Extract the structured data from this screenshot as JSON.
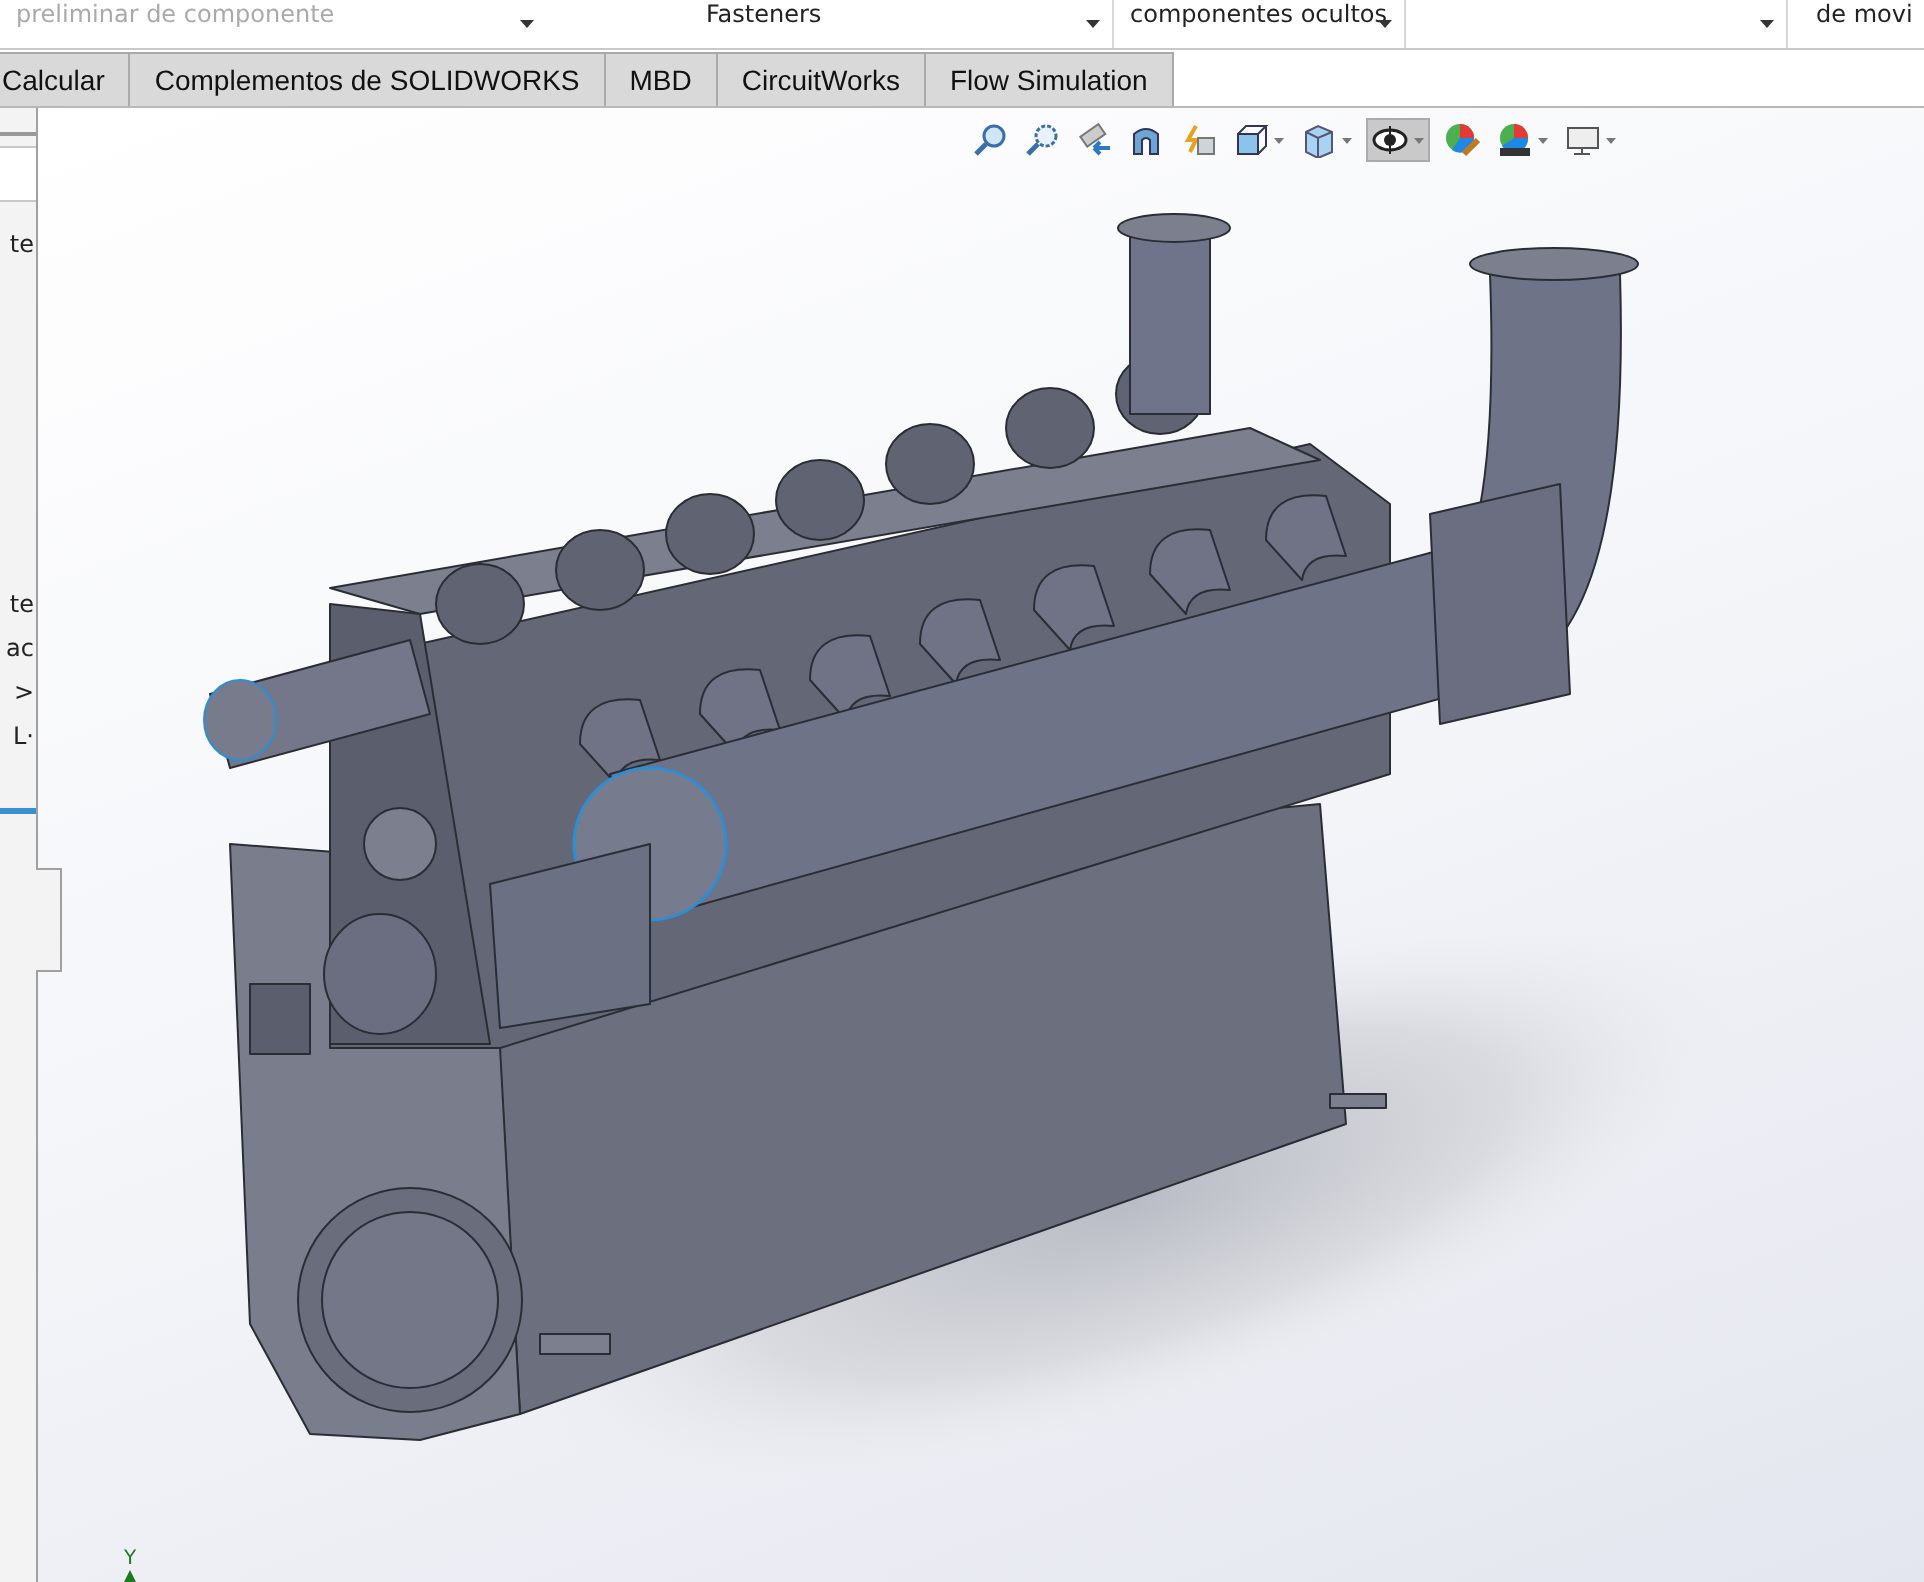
{
  "ribbon": {
    "items": [
      {
        "label": "preliminar de componente",
        "dropdown": true
      },
      {
        "label": "Fasteners",
        "dropdown": true
      },
      {
        "label": "componentes ocultos",
        "dropdown": true
      },
      {
        "dropdown": true
      },
      {
        "label": "de movi",
        "dropdown": false
      }
    ]
  },
  "tabs": [
    {
      "label": "Calcular"
    },
    {
      "label": "Complementos de SOLIDWORKS"
    },
    {
      "label": "MBD"
    },
    {
      "label": "CircuitWorks"
    },
    {
      "label": "Flow Simulation"
    }
  ],
  "left_panel": {
    "items": [
      {
        "label": "te"
      },
      {
        "label": "te"
      },
      {
        "label": "ac"
      },
      {
        "label": ">"
      },
      {
        "label": "L·"
      }
    ]
  },
  "view_toolbar": [
    {
      "kind": "zoom-fit",
      "dropdown": false,
      "pressed": false
    },
    {
      "kind": "zoom-area",
      "dropdown": false,
      "pressed": false
    },
    {
      "kind": "previous-view",
      "dropdown": false,
      "pressed": false
    },
    {
      "kind": "section",
      "dropdown": false,
      "pressed": false
    },
    {
      "kind": "annotation",
      "dropdown": false,
      "pressed": false
    },
    {
      "kind": "orientation",
      "dropdown": true,
      "pressed": false
    },
    {
      "kind": "display-style",
      "dropdown": true,
      "pressed": false
    },
    {
      "kind": "hide-show",
      "dropdown": true,
      "pressed": true
    },
    {
      "kind": "appearance",
      "dropdown": false,
      "pressed": false
    },
    {
      "kind": "scene",
      "dropdown": true,
      "pressed": false
    },
    {
      "kind": "view-settings",
      "dropdown": true,
      "pressed": false
    }
  ],
  "triad": {
    "axis_label": "Y"
  }
}
